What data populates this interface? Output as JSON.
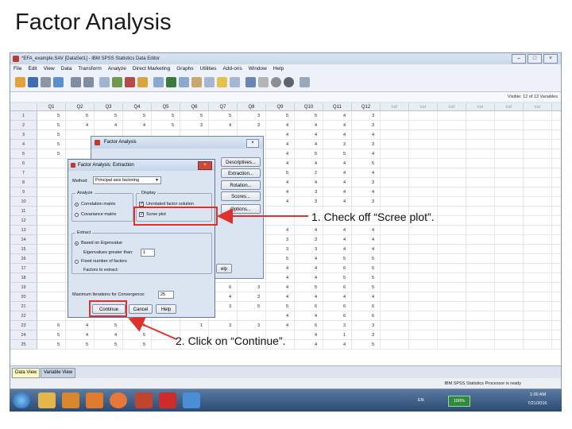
{
  "slide_title": "Factor Analysis",
  "window": {
    "title": "*EFA_example.SAV [DataSet1] - IBM SPSS Statistics Data Editor",
    "controls": [
      "–",
      "□",
      "×"
    ],
    "menu": [
      "File",
      "Edit",
      "View",
      "Data",
      "Transform",
      "Analyze",
      "Direct Marketing",
      "Graphs",
      "Utilities",
      "Add-ons",
      "Window",
      "Help"
    ],
    "visible_info": "Visible: 12 of 13 Variables"
  },
  "grid": {
    "columns": [
      "Q1",
      "Q2",
      "Q3",
      "Q4",
      "Q5",
      "Q6",
      "Q7",
      "Q8",
      "Q9",
      "Q10",
      "Q11",
      "Q12",
      "var",
      "var",
      "var",
      "var",
      "var",
      "var",
      "var"
    ],
    "rows": [
      [
        "1",
        "5",
        "5",
        "5",
        "5",
        "5",
        "5",
        "5",
        "3",
        "5",
        "5",
        "4",
        "3"
      ],
      [
        "2",
        "5",
        "4",
        "4",
        "4",
        "5",
        "3",
        "4",
        "3",
        "4",
        "4",
        "4",
        "3"
      ],
      [
        "3",
        "5",
        "",
        "",
        "",
        "",
        "",
        "",
        "",
        "4",
        "4",
        "4",
        "4"
      ],
      [
        "4",
        "5",
        "",
        "",
        "",
        "",
        "",
        "",
        "",
        "4",
        "4",
        "3",
        "3"
      ],
      [
        "5",
        "5",
        "",
        "",
        "",
        "",
        "",
        "",
        "",
        "4",
        "5",
        "5",
        "4"
      ],
      [
        "6",
        "",
        "",
        "",
        "",
        "",
        "",
        "",
        "",
        "4",
        "4",
        "4",
        "5"
      ],
      [
        "7",
        "",
        "",
        "",
        "",
        "",
        "",
        "",
        "",
        "5",
        "2",
        "4",
        "4"
      ],
      [
        "8",
        "",
        "",
        "",
        "",
        "",
        "",
        "",
        "",
        "4",
        "4",
        "4",
        "3"
      ],
      [
        "9",
        "",
        "",
        "",
        "",
        "",
        "",
        "",
        "",
        "4",
        "3",
        "4",
        "4"
      ],
      [
        "10",
        "",
        "",
        "",
        "",
        "",
        "",
        "",
        "",
        "4",
        "3",
        "4",
        "3"
      ],
      [
        "11",
        "",
        "",
        "",
        "",
        "",
        "",
        "",
        "",
        "",
        "",
        "",
        ""
      ],
      [
        "12",
        "",
        "",
        "",
        "",
        "",
        "",
        "",
        "",
        "",
        "",
        "",
        ""
      ],
      [
        "13",
        "",
        "",
        "",
        "",
        "",
        "",
        "",
        "",
        "4",
        "4",
        "4",
        "4"
      ],
      [
        "14",
        "",
        "",
        "",
        "",
        "",
        "",
        "",
        "",
        "3",
        "3",
        "4",
        "4"
      ],
      [
        "15",
        "",
        "",
        "",
        "",
        "",
        "",
        "",
        "",
        "3",
        "3",
        "4",
        "4"
      ],
      [
        "16",
        "",
        "",
        "",
        "",
        "",
        "",
        "",
        "",
        "5",
        "4",
        "5",
        "5"
      ],
      [
        "17",
        "",
        "",
        "",
        "",
        "",
        "",
        "",
        "",
        "4",
        "4",
        "6",
        "6"
      ],
      [
        "18",
        "",
        "",
        "",
        "",
        "",
        "",
        "",
        "",
        "4",
        "4",
        "5",
        "5"
      ],
      [
        "19",
        "",
        "",
        "",
        "",
        "",
        "5",
        "6",
        "3",
        "4",
        "5",
        "6",
        "5"
      ],
      [
        "20",
        "",
        "",
        "",
        "",
        "",
        "4",
        "4",
        "3",
        "4",
        "4",
        "4",
        "4"
      ],
      [
        "21",
        "",
        "",
        "",
        "",
        "",
        "5",
        "3",
        "5",
        "5",
        "6",
        "6",
        "6"
      ],
      [
        "22",
        "",
        "",
        "",
        "",
        "",
        "",
        "",
        "",
        "4",
        "4",
        "6",
        "6"
      ],
      [
        "23",
        "6",
        "4",
        "5",
        "5",
        "",
        "1",
        "3",
        "3",
        "4",
        "6",
        "3",
        "3"
      ],
      [
        "24",
        "5",
        "4",
        "4",
        "5",
        "",
        "",
        "",
        "",
        "",
        "4",
        "1",
        "3"
      ],
      [
        "25",
        "5",
        "5",
        "5",
        "5",
        "",
        "",
        "",
        "",
        "",
        "4",
        "4",
        "5"
      ]
    ]
  },
  "tabs": {
    "data_view": "Data View",
    "variable_view": "Variable View"
  },
  "status": "IBM SPSS Statistics Processor is ready",
  "dialog_main": {
    "title": "Factor Analysis",
    "buttons": {
      "descriptives": "Descriptives...",
      "extraction": "Extraction...",
      "rotation": "Rotation...",
      "scores": "Scores...",
      "options": "Options..."
    },
    "help_fragment": "elp"
  },
  "dialog_extraction": {
    "title": "Factor Analysis: Extraction",
    "method_label": "Method:",
    "method_value": "Principal axis factoring",
    "analyze_group": "Analyze",
    "correlation_matrix": "Correlation matrix",
    "covariance_matrix": "Covariance matrix",
    "display_group": "Display",
    "unrotated_solution": "Unrotated factor solution",
    "scree_plot": "Scree plot",
    "extract_group": "Extract",
    "based_on_eigenvalue": "Based on Eigenvalue",
    "eigenvalues_greater": "Eigenvalues greater than:",
    "eigen_value": "1",
    "fixed_number": "Fixed number of factors",
    "factors_to_extract": "Factors to extract:",
    "max_iterations_label": "Maximum Iterations for Convergence:",
    "max_iterations_value": "25",
    "continue": "Continue",
    "cancel": "Cancel",
    "help": "Help"
  },
  "annotations": {
    "step1": "1. Check off “Scree plot”.",
    "step2": "2. Click on “Continue”."
  },
  "taskbar": {
    "lang": "EN",
    "zoom": "100%",
    "time": "1:00 AM",
    "date": "7/21/2016"
  },
  "colors": {
    "highlight": "#e0302b",
    "active_tab": "#fff7c0",
    "taskbar": "#2c4a72"
  }
}
